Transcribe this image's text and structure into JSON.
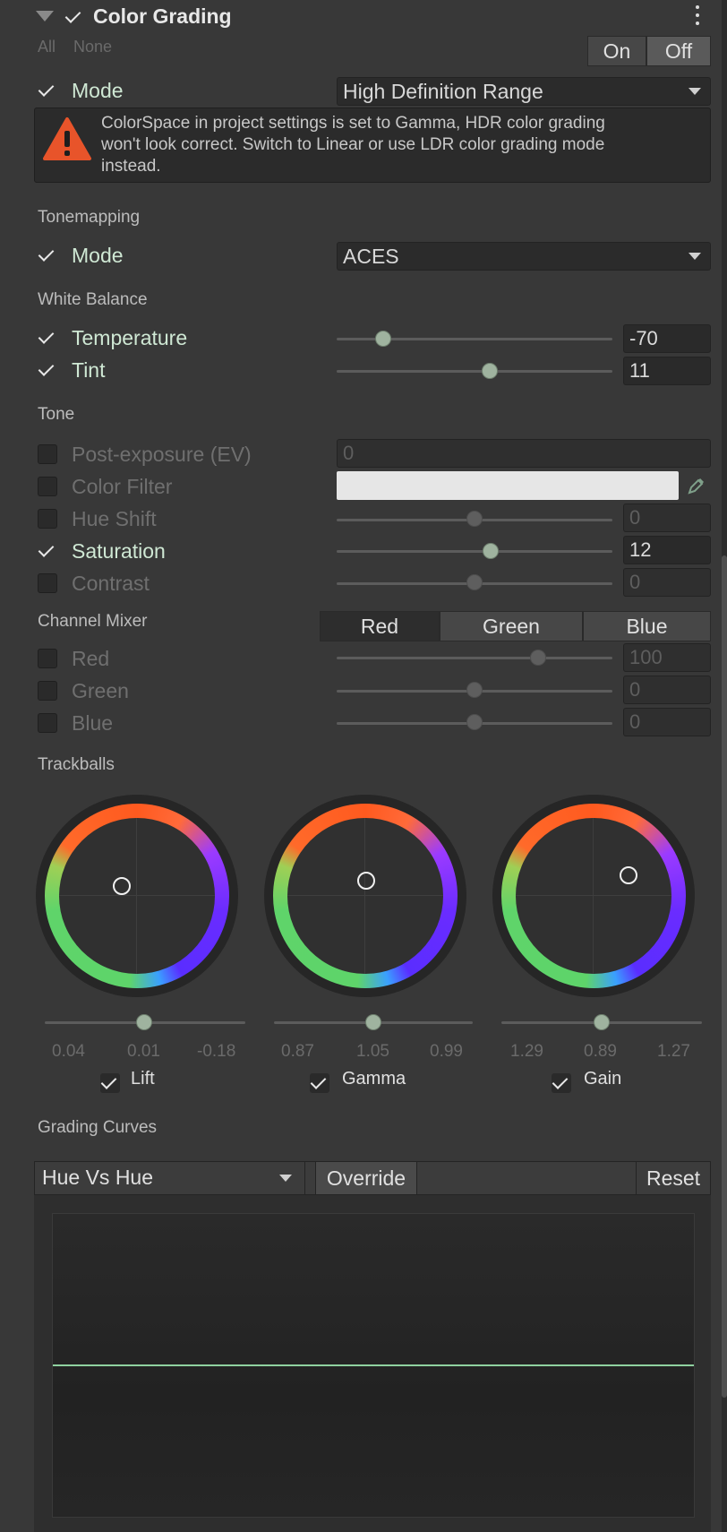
{
  "header": {
    "title": "Color Grading",
    "all": "All",
    "none": "None",
    "on": "On",
    "off": "Off"
  },
  "mode": {
    "label": "Mode",
    "value": "High Definition Range"
  },
  "warning": {
    "text1": "ColorSpace in project settings is set to Gamma, HDR color grading",
    "text2": "won't look correct. Switch to Linear or use LDR color grading mode",
    "text3": "instead."
  },
  "tonemapping": {
    "section": "Tonemapping",
    "mode_label": "Mode",
    "mode_value": "ACES"
  },
  "white_balance": {
    "section": "White Balance",
    "temperature": {
      "label": "Temperature",
      "value": "-70",
      "level": 0.15
    },
    "tint": {
      "label": "Tint",
      "value": "11",
      "level": 0.55
    }
  },
  "tone": {
    "section": "Tone",
    "post_exposure": {
      "label": "Post-exposure (EV)",
      "value": "0"
    },
    "color_filter": {
      "label": "Color Filter"
    },
    "hue_shift": {
      "label": "Hue Shift",
      "value": "0"
    },
    "saturation": {
      "label": "Saturation",
      "value": "12"
    },
    "contrast": {
      "label": "Contrast",
      "value": "0"
    }
  },
  "channel_mixer": {
    "section": "Channel Mixer",
    "tabs": [
      "Red",
      "Green",
      "Blue"
    ],
    "red": {
      "label": "Red",
      "value": "100"
    },
    "green": {
      "label": "Green",
      "value": "0"
    },
    "blue": {
      "label": "Blue",
      "value": "0"
    }
  },
  "trackballs": {
    "section": "Trackballs",
    "lift": {
      "label": "Lift",
      "values": [
        "0.04",
        "0.01",
        "-0.18"
      ]
    },
    "gamma": {
      "label": "Gamma",
      "values": [
        "0.87",
        "1.05",
        "0.99"
      ]
    },
    "gain": {
      "label": "Gain",
      "values": [
        "1.29",
        "0.89",
        "1.27"
      ]
    }
  },
  "grading_curves": {
    "section": "Grading Curves",
    "curve_select": "Hue Vs Hue",
    "override": "Override",
    "reset": "Reset"
  },
  "colors": {
    "accent_green": "#9fd3a6",
    "warning_orange": "#e8542a"
  },
  "icons": [
    "foldout-arrow-icon",
    "checkmark-icon",
    "kebab-menu-icon",
    "dropdown-arrow-icon",
    "warning-icon",
    "eyedropper-icon"
  ]
}
